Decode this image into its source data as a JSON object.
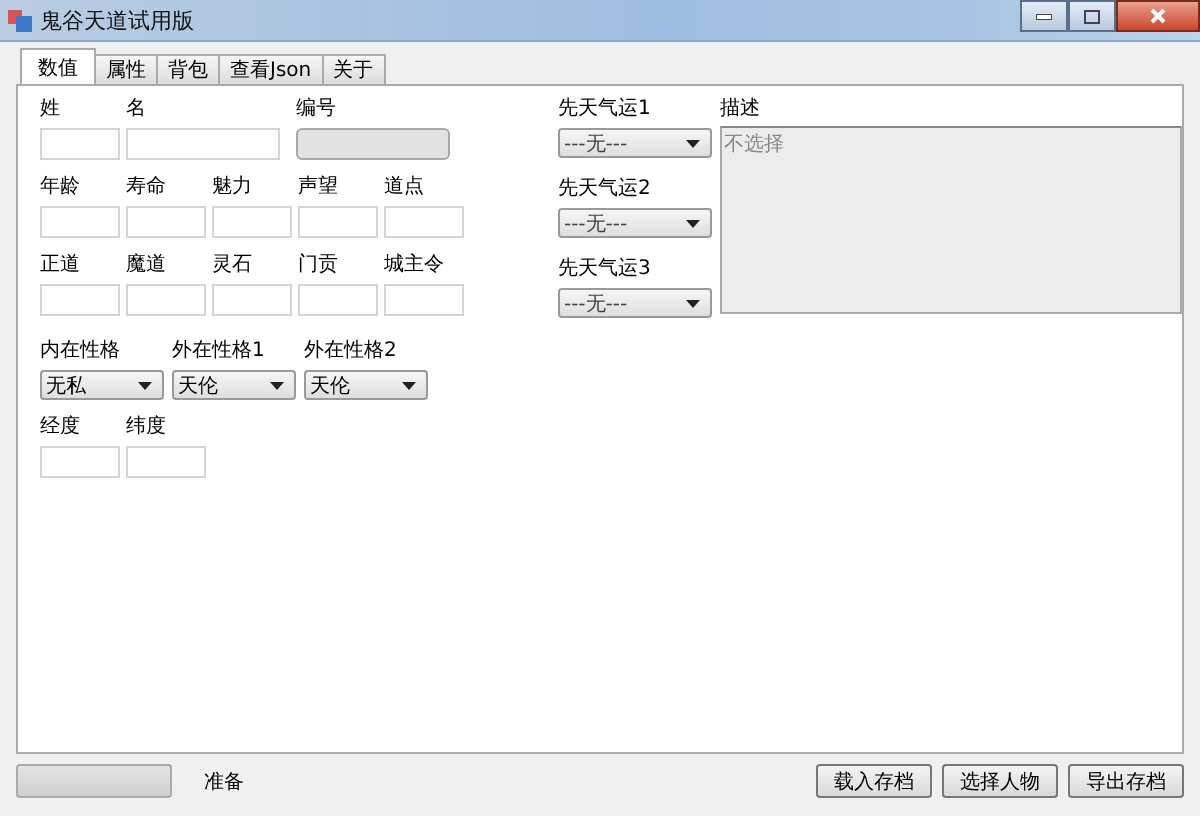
{
  "window": {
    "title": "鬼谷天道试用版"
  },
  "tabs": [
    {
      "label": "数值",
      "selected": true
    },
    {
      "label": "属性",
      "selected": false
    },
    {
      "label": "背包",
      "selected": false
    },
    {
      "label": "查看Json",
      "selected": false
    },
    {
      "label": "关于",
      "selected": false
    }
  ],
  "field_rows": [
    [
      {
        "label": "姓",
        "disabled": false
      },
      {
        "label": "名",
        "disabled": false
      },
      {
        "label": "编号",
        "disabled": true
      }
    ],
    [
      {
        "label": "年龄",
        "disabled": false
      },
      {
        "label": "寿命",
        "disabled": false
      },
      {
        "label": "魅力",
        "disabled": false
      },
      {
        "label": "声望",
        "disabled": false
      },
      {
        "label": "道点",
        "disabled": false
      }
    ],
    [
      {
        "label": "正道",
        "disabled": false
      },
      {
        "label": "魔道",
        "disabled": false
      },
      {
        "label": "灵石",
        "disabled": false
      },
      {
        "label": "门贡",
        "disabled": false
      },
      {
        "label": "城主令",
        "disabled": false
      }
    ]
  ],
  "personality": [
    {
      "label": "内在性格",
      "value": "无私"
    },
    {
      "label": "外在性格1",
      "value": "天伦"
    },
    {
      "label": "外在性格2",
      "value": "天伦"
    }
  ],
  "coordinates": [
    {
      "label": "经度",
      "disabled": false
    },
    {
      "label": "纬度",
      "disabled": false
    }
  ],
  "fortunes": [
    {
      "label": "先天气运1",
      "value": "---无---"
    },
    {
      "label": "先天气运2",
      "value": "---无---"
    },
    {
      "label": "先天气运3",
      "value": "---无---"
    }
  ],
  "description": {
    "label": "描述",
    "value": "不选择",
    "disabled": true
  },
  "status_bar": {
    "progress": {
      "level": 0
    },
    "text": "准备",
    "buttons": [
      "载入存档",
      "选择人物",
      "导出存档"
    ]
  }
}
